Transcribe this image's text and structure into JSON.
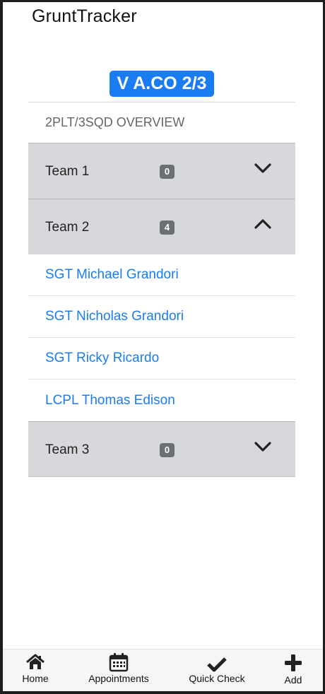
{
  "app": {
    "title": "GruntTracker"
  },
  "unit_badge": "V A.CO 2/3",
  "overview_title": "2PLT/3SQD OVERVIEW",
  "teams": [
    {
      "label": "Team 1",
      "count": "0",
      "expanded": false,
      "members": []
    },
    {
      "label": "Team 2",
      "count": "4",
      "expanded": true,
      "members": [
        "SGT Michael Grandori",
        "SGT Nicholas Grandori",
        "SGT Ricky Ricardo",
        "LCPL Thomas Edison"
      ]
    },
    {
      "label": "Team 3",
      "count": "0",
      "expanded": false,
      "members": []
    }
  ],
  "tabbar": {
    "items": [
      {
        "label": "Home",
        "icon": "home-icon"
      },
      {
        "label": "Appointments",
        "icon": "calendar-icon"
      },
      {
        "label": "Quick Check",
        "icon": "check-icon"
      },
      {
        "label": "Add",
        "icon": "plus-icon"
      }
    ]
  },
  "colors": {
    "accent": "#1a7cf2",
    "team_bg": "#d7d8db",
    "badge_bg": "#6b7077"
  }
}
